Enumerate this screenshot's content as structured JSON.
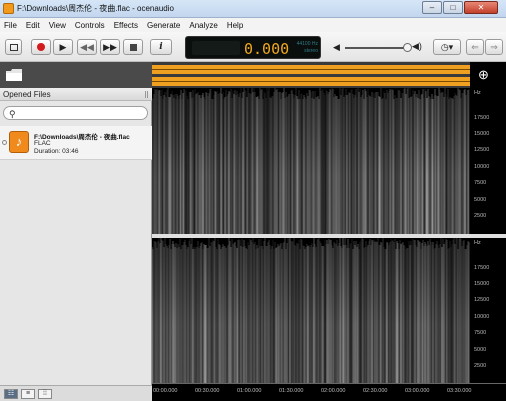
{
  "window": {
    "title": "F:\\Downloads\\周杰伦 - 夜曲.flac - ocenaudio",
    "controls": [
      "minimize",
      "maximize",
      "close"
    ]
  },
  "menu": [
    "File",
    "Edit",
    "View",
    "Controls",
    "Effects",
    "Generate",
    "Analyze",
    "Help"
  ],
  "toolbar": {
    "time_display": "0.000",
    "sample_rate": "44100 Hz",
    "channel_mode": "stereo",
    "volume_level": 0.9
  },
  "sidebar": {
    "header": "Opened Files",
    "search_placeholder": "",
    "files": [
      {
        "path": "F:\\Downloads\\周杰伦 - 夜曲.flac",
        "format": "FLAC",
        "duration": "Duration: 03:46"
      }
    ]
  },
  "frequency_axis": {
    "unit": "Hz",
    "ticks": [
      "17500",
      "15000",
      "12500",
      "10000",
      "7500",
      "5000",
      "2500"
    ]
  },
  "timeline": {
    "ticks": [
      "00:00.000",
      "00:30.000",
      "01:00.000",
      "01:30.000",
      "02:00.000",
      "02:30.000",
      "03:00.000",
      "03:30.000"
    ]
  },
  "colors": {
    "overview_wave": "#f0a020",
    "lcd_time": "#f2a81d",
    "accent_file_icon": "#f08a1c",
    "record": "#d31b1b"
  }
}
